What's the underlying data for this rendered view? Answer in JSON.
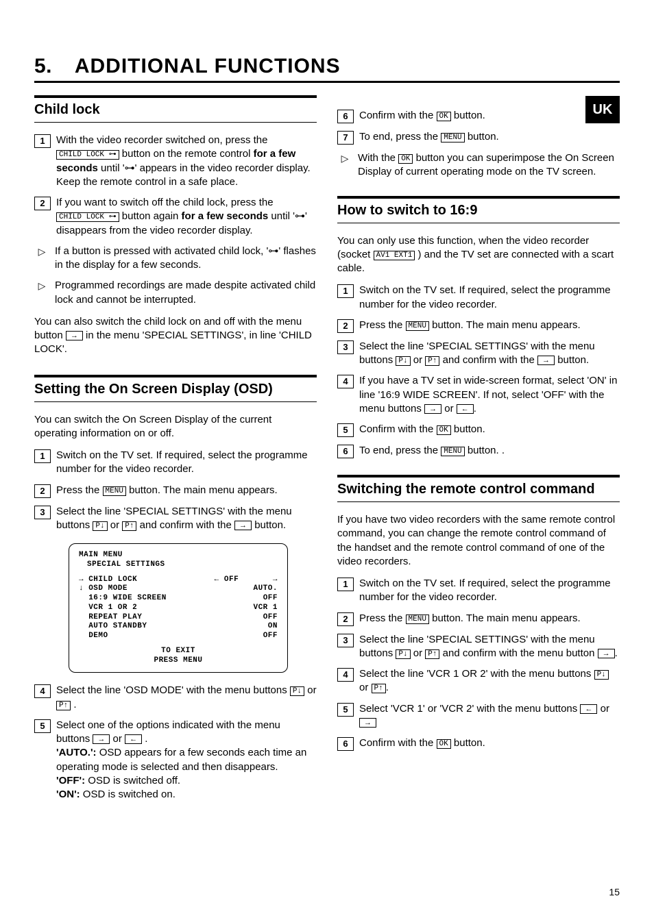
{
  "chapter": {
    "number": "5.",
    "title": "ADDITIONAL FUNCTIONS"
  },
  "region_badge": "UK",
  "page_number": "15",
  "left": {
    "child_lock": {
      "heading": "Child lock",
      "steps": [
        {
          "n": "1",
          "pre": "With the video recorder switched on, press the ",
          "btn": "CHILD LOCK ⊶",
          "post1": " button on the remote control ",
          "bold1": "for a few seconds",
          "post2": " until '⊶' appears in the video recorder display. Keep the remote control in a safe place."
        },
        {
          "n": "2",
          "pre": "If you want to switch off the child lock, press the ",
          "btn": "CHILD LOCK ⊶",
          "post1": " button again ",
          "bold1": "for a few seconds",
          "post2": " until '⊶' disappears from the video recorder display."
        }
      ],
      "notes": [
        "If a button is pressed with activated child lock, '⊶' flashes in the display for a few seconds.",
        "Programmed recordings are made despite activated child lock and cannot be interrupted."
      ],
      "tail": {
        "pre": "You can also switch the child lock on and off with the menu button ",
        "btn": "→",
        "post": " in the menu 'SPECIAL SETTINGS', in line 'CHILD LOCK'."
      }
    },
    "osd": {
      "heading": "Setting the On Screen Display (OSD)",
      "intro": "You can switch the On Screen Display of the current operating information on or off.",
      "steps": [
        {
          "n": "1",
          "text": "Switch on the TV set. If required, select the programme number for the video recorder."
        },
        {
          "n": "2",
          "pre": "Press the ",
          "btn": "MENU",
          "post": " button. The main menu appears."
        },
        {
          "n": "3",
          "pre": "Select the line 'SPECIAL SETTINGS' with the menu buttons ",
          "b1": "P↓",
          "mid": " or ",
          "b2": "P↑",
          "post1": " and confirm with the ",
          "b3": "→",
          "post2": " button."
        }
      ],
      "panel": {
        "title1": "MAIN MENU",
        "title2": "SPECIAL SETTINGS",
        "rows": [
          {
            "l": "→ CHILD LOCK",
            "r": "← OFF       →"
          },
          {
            "l": "↓ OSD MODE",
            "r": "AUTO."
          },
          {
            "l": "  16:9 WIDE SCREEN",
            "r": "OFF"
          },
          {
            "l": "  VCR 1 OR 2",
            "r": "VCR 1"
          },
          {
            "l": "  REPEAT PLAY",
            "r": "OFF"
          },
          {
            "l": "  AUTO STANDBY",
            "r": "ON"
          },
          {
            "l": "  DEMO",
            "r": "OFF"
          }
        ],
        "exit1": "TO EXIT",
        "exit2": "PRESS    MENU"
      },
      "steps2": [
        {
          "n": "4",
          "pre": "Select the line 'OSD MODE' with the menu buttons ",
          "b1": "P↓",
          "mid": " or ",
          "b2": "P↑",
          "post": "."
        },
        {
          "n": "5",
          "pre": "Select one of the options indicated with the menu buttons ",
          "b1": "→",
          "mid": " or ",
          "b2": "←",
          "post": ".",
          "lines": [
            {
              "k": "'AUTO.':",
              "v": " OSD appears for a few seconds each time an operating mode is selected and then disappears."
            },
            {
              "k": "'OFF':",
              "v": " OSD is switched off."
            },
            {
              "k": "'ON':",
              "v": " OSD is switched on."
            }
          ]
        }
      ]
    }
  },
  "right": {
    "continuation": {
      "steps": [
        {
          "n": "6",
          "pre": "Confirm with the ",
          "btn": "OK",
          "post": " button."
        },
        {
          "n": "7",
          "pre": "To end, press the ",
          "btn": "MENU",
          "post": " button."
        }
      ],
      "note": {
        "pre": "With the ",
        "btn": "OK",
        "post": " button you can superimpose the On Screen Display of current operating mode on the TV screen."
      }
    },
    "sixteen_nine": {
      "heading": "How to switch to 16:9",
      "intro": {
        "pre": "You can only use this function, when the video recorder (socket ",
        "btn": "AV1 EXT1",
        "post": " ) and the TV set are connected with a scart cable."
      },
      "steps": [
        {
          "n": "1",
          "text": "Switch on the TV set. If required, select the programme number for the video recorder."
        },
        {
          "n": "2",
          "pre": "Press the ",
          "btn": "MENU",
          "post": " button. The main menu appears."
        },
        {
          "n": "3",
          "pre": "Select the line 'SPECIAL SETTINGS' with the menu buttons ",
          "b1": "P↓",
          "mid": " or ",
          "b2": "P↑",
          "post1": " and confirm with the ",
          "b3": "→",
          "post2": " button."
        },
        {
          "n": "4",
          "pre": "If you have a TV set in wide-screen format, select 'ON' in line '16:9 WIDE SCREEN'. If not, select 'OFF' with the menu buttons ",
          "b1": "→",
          "mid": " or ",
          "b2": "←",
          "post": "."
        },
        {
          "n": "5",
          "pre": "Confirm with the ",
          "btn": "OK",
          "post": " button."
        },
        {
          "n": "6",
          "pre": "To end, press the ",
          "btn": "MENU",
          "post": " button.  ."
        }
      ]
    },
    "remote_cmd": {
      "heading": "Switching the remote control command",
      "intro": "If you have two video recorders with the same remote control command, you can change the remote control command of the handset and the remote control command of one of the video recorders.",
      "steps": [
        {
          "n": "1",
          "text": "Switch on the TV set. If required, select the programme number for the video recorder."
        },
        {
          "n": "2",
          "pre": "Press the ",
          "btn": "MENU",
          "post": " button. The main menu appears."
        },
        {
          "n": "3",
          "pre": "Select the line 'SPECIAL SETTINGS' with the menu buttons ",
          "b1": "P↓",
          "mid": " or ",
          "b2": "P↑",
          "post1": " and confirm with the menu button ",
          "b3": "→",
          "post2": "."
        },
        {
          "n": "4",
          "pre": "Select the line 'VCR 1 OR 2' with the menu buttons ",
          "b1": "P↓",
          "mid": " or ",
          "b2": "P↑",
          "post": "."
        },
        {
          "n": "5",
          "pre": "Select 'VCR 1' or 'VCR 2' with the menu buttons ",
          "b1": "←",
          "mid": " or ",
          "b2": "→",
          "post": ""
        },
        {
          "n": "6",
          "pre": "Confirm with the ",
          "btn": "OK",
          "post": " button."
        }
      ]
    }
  }
}
